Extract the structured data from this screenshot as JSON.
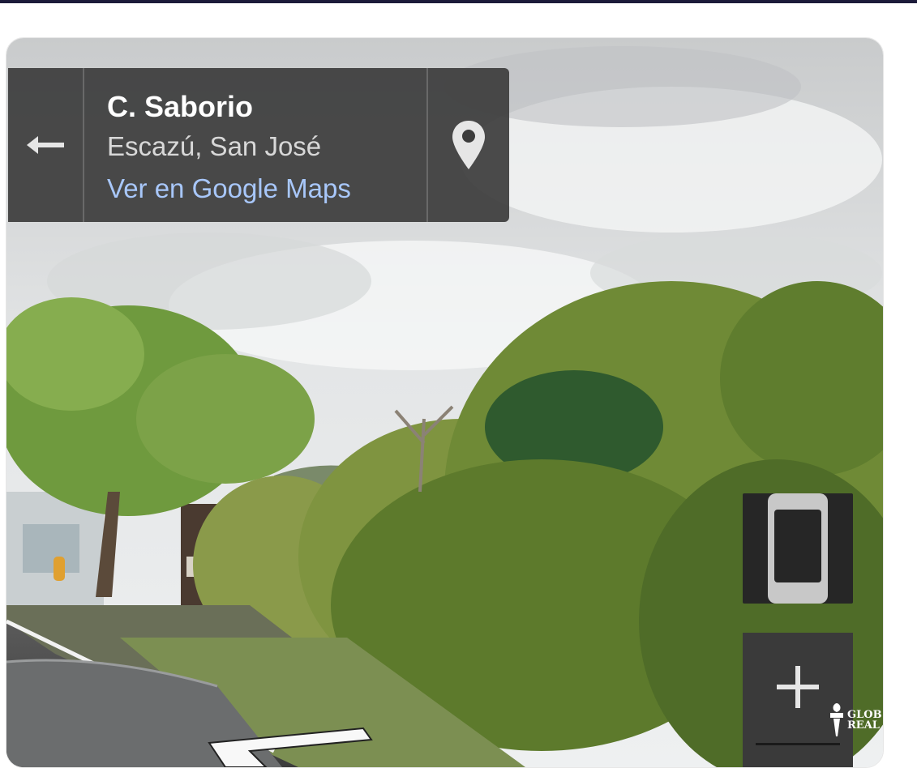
{
  "location_card": {
    "street": "C. Saborio",
    "city": "Escazú, San José",
    "maps_link": "Ver en Google Maps"
  },
  "icons": {
    "back": "arrow-left-icon",
    "pin": "map-pin-icon",
    "device": "phone-orientation-icon",
    "zoom": "plus-icon"
  },
  "watermark": {
    "line1": "GLOB",
    "line2": "REAL"
  },
  "colors": {
    "top_bar": "#1c1b3a",
    "card_bg": "#3c3c3c",
    "link": "#a8c7fa",
    "control_bg": "#262626"
  }
}
